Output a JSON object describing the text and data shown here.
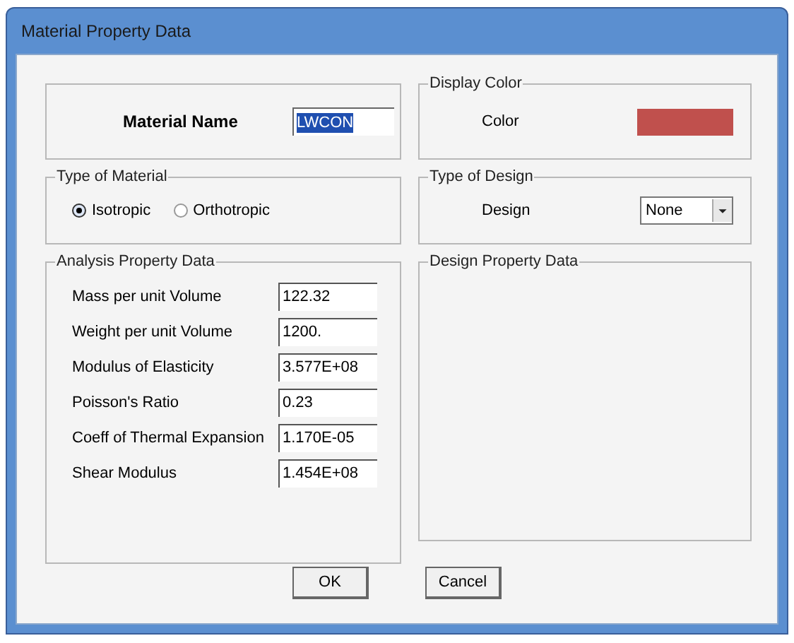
{
  "window": {
    "title": "Material Property Data"
  },
  "material_name": {
    "label": "Material Name",
    "value": "LWCON",
    "value_selected": true
  },
  "display_color": {
    "title": "Display Color",
    "label": "Color",
    "color": "#c0504d"
  },
  "type_of_material": {
    "title": "Type of Material",
    "options": [
      {
        "label": "Isotropic",
        "selected": true
      },
      {
        "label": "Orthotropic",
        "selected": false
      }
    ]
  },
  "type_of_design": {
    "title": "Type of Design",
    "label": "Design",
    "value": "None"
  },
  "analysis_property_data": {
    "title": "Analysis Property Data",
    "rows": [
      {
        "label": "Mass per unit Volume",
        "value": "122.32"
      },
      {
        "label": "Weight per unit Volume",
        "value": "1200."
      },
      {
        "label": "Modulus of Elasticity",
        "value": "3.577E+08"
      },
      {
        "label": "Poisson's Ratio",
        "value": "0.23"
      },
      {
        "label": "Coeff of Thermal Expansion",
        "value": "1.170E-05"
      },
      {
        "label": "Shear Modulus",
        "value": "1.454E+08"
      }
    ]
  },
  "design_property_data": {
    "title": "Design Property Data"
  },
  "buttons": [
    "OK",
    "Cancel"
  ]
}
